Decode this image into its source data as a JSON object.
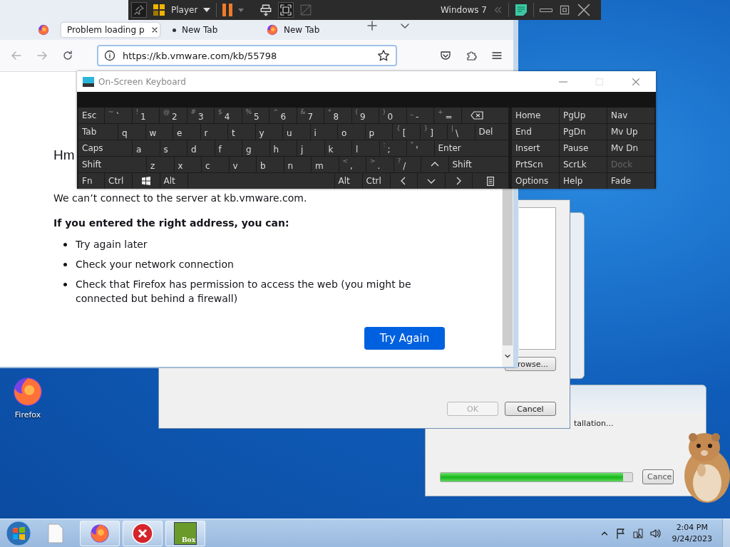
{
  "vm_toolbar": {
    "menu": "Player",
    "vm_name": "Windows 7"
  },
  "browser": {
    "tabs": [
      {
        "kind": "pinned",
        "selected": false,
        "favicon": true,
        "attention": false
      },
      {
        "kind": "page",
        "label": "Problem loading p",
        "selected": true,
        "favicon": false,
        "attention": false
      },
      {
        "kind": "page",
        "label": "New Tab",
        "selected": false,
        "favicon": false,
        "attention": true
      },
      {
        "kind": "page",
        "label": "New Tab",
        "selected": false,
        "favicon": true,
        "attention": false
      }
    ],
    "url": "https://kb.vmware.com/kb/55798",
    "error_page": {
      "heading": "Hm",
      "message": "We can’t connect to the server at kb.vmware.com.",
      "suggestion_title": "If you entered the right address, you can:",
      "suggestions": [
        "Try again later",
        "Check your network connection",
        "Check that Firefox has permission to access the web (you might be connected but behind a firewall)"
      ],
      "button": "Try Again"
    }
  },
  "keyboard": {
    "title": "On-Screen Keyboard",
    "rows": [
      {
        "keys": [
          {
            "kind": "mod",
            "label": "Esc"
          },
          {
            "kind": "char",
            "shift": "~",
            "label": "`"
          },
          {
            "kind": "char",
            "shift": "!",
            "label": "1"
          },
          {
            "kind": "char",
            "shift": "@",
            "label": "2"
          },
          {
            "kind": "char",
            "shift": "#",
            "label": "3"
          },
          {
            "kind": "char",
            "shift": "$",
            "label": "4"
          },
          {
            "kind": "char",
            "shift": "%",
            "label": "5"
          },
          {
            "kind": "char",
            "shift": "^",
            "label": "6"
          },
          {
            "kind": "char",
            "shift": "&",
            "label": "7"
          },
          {
            "kind": "char",
            "shift": "*",
            "label": "8"
          },
          {
            "kind": "char",
            "shift": "(",
            "label": "9"
          },
          {
            "kind": "char",
            "shift": ")",
            "label": "0"
          },
          {
            "kind": "char",
            "shift": "_",
            "label": "-"
          },
          {
            "kind": "char",
            "shift": "+",
            "label": "="
          },
          {
            "kind": "backspace"
          }
        ]
      },
      {
        "keys": [
          {
            "kind": "mod",
            "label": "Tab"
          },
          {
            "kind": "char",
            "label": "q"
          },
          {
            "kind": "char",
            "label": "w"
          },
          {
            "kind": "char",
            "label": "e"
          },
          {
            "kind": "char",
            "label": "r"
          },
          {
            "kind": "char",
            "label": "t"
          },
          {
            "kind": "char",
            "label": "y"
          },
          {
            "kind": "char",
            "label": "u"
          },
          {
            "kind": "char",
            "label": "i"
          },
          {
            "kind": "char",
            "label": "o"
          },
          {
            "kind": "char",
            "label": "p"
          },
          {
            "kind": "char",
            "shift": "{",
            "label": "["
          },
          {
            "kind": "char",
            "shift": "}",
            "label": "]"
          },
          {
            "kind": "char",
            "shift": "|",
            "label": "\\"
          },
          {
            "kind": "mod",
            "label": "Del"
          }
        ]
      },
      {
        "keys": [
          {
            "kind": "mod",
            "label": "Caps"
          },
          {
            "kind": "char",
            "label": "a"
          },
          {
            "kind": "char",
            "label": "s"
          },
          {
            "kind": "char",
            "label": "d"
          },
          {
            "kind": "char",
            "label": "f"
          },
          {
            "kind": "char",
            "label": "g"
          },
          {
            "kind": "char",
            "label": "h"
          },
          {
            "kind": "char",
            "label": "j"
          },
          {
            "kind": "char",
            "label": "k"
          },
          {
            "kind": "char",
            "label": "l"
          },
          {
            "kind": "char",
            "shift": ":",
            "label": ";"
          },
          {
            "kind": "char",
            "shift": "\"",
            "label": "'"
          },
          {
            "kind": "mod",
            "label": "Enter"
          }
        ]
      },
      {
        "keys": [
          {
            "kind": "mod",
            "label": "Shift"
          },
          {
            "kind": "char",
            "label": "z"
          },
          {
            "kind": "char",
            "label": "x"
          },
          {
            "kind": "char",
            "label": "c"
          },
          {
            "kind": "char",
            "label": "v"
          },
          {
            "kind": "char",
            "label": "b"
          },
          {
            "kind": "char",
            "label": "n"
          },
          {
            "kind": "char",
            "label": "m"
          },
          {
            "kind": "char",
            "shift": "<",
            "label": ","
          },
          {
            "kind": "char",
            "shift": ">",
            "label": "."
          },
          {
            "kind": "char",
            "shift": "?",
            "label": "/"
          },
          {
            "kind": "up"
          },
          {
            "kind": "mod",
            "label": "Shift"
          }
        ]
      },
      {
        "keys": [
          {
            "kind": "mod",
            "label": "Fn"
          },
          {
            "kind": "mod",
            "label": "Ctrl"
          },
          {
            "kind": "windows"
          },
          {
            "kind": "mod",
            "label": "Alt"
          },
          {
            "kind": "space"
          },
          {
            "kind": "mod",
            "label": "Alt"
          },
          {
            "kind": "mod",
            "label": "Ctrl"
          },
          {
            "kind": "left"
          },
          {
            "kind": "down"
          },
          {
            "kind": "right"
          },
          {
            "kind": "menu"
          }
        ]
      }
    ],
    "nav_keys": [
      {
        "label": "Home",
        "disabled": false
      },
      {
        "label": "PgUp",
        "disabled": false
      },
      {
        "label": "Nav",
        "disabled": false
      },
      {
        "label": "End",
        "disabled": false
      },
      {
        "label": "PgDn",
        "disabled": false
      },
      {
        "label": "Mv Up",
        "disabled": false
      },
      {
        "label": "Insert",
        "disabled": false
      },
      {
        "label": "Pause",
        "disabled": false
      },
      {
        "label": "Mv Dn",
        "disabled": false
      },
      {
        "label": "PrtScn",
        "disabled": false
      },
      {
        "label": "ScrLk",
        "disabled": false
      },
      {
        "label": "Dock",
        "disabled": true
      },
      {
        "label": "Options",
        "disabled": false
      },
      {
        "label": "Help",
        "disabled": false
      },
      {
        "label": "Fade",
        "disabled": false
      }
    ]
  },
  "dialog": {
    "browse": "rowse...",
    "buttons": [
      {
        "label": "OK",
        "disabled": true
      },
      {
        "label": "Cancel",
        "disabled": false
      }
    ]
  },
  "installer": {
    "status": "tallation...",
    "progress": {
      "level": 0.95
    },
    "cancel": "Cance"
  },
  "desktop_icons": [
    {
      "label": "Firefox"
    }
  ],
  "taskbar": {
    "app_badge": "Box",
    "time": "2:04 PM",
    "date": "9/24/2023"
  }
}
